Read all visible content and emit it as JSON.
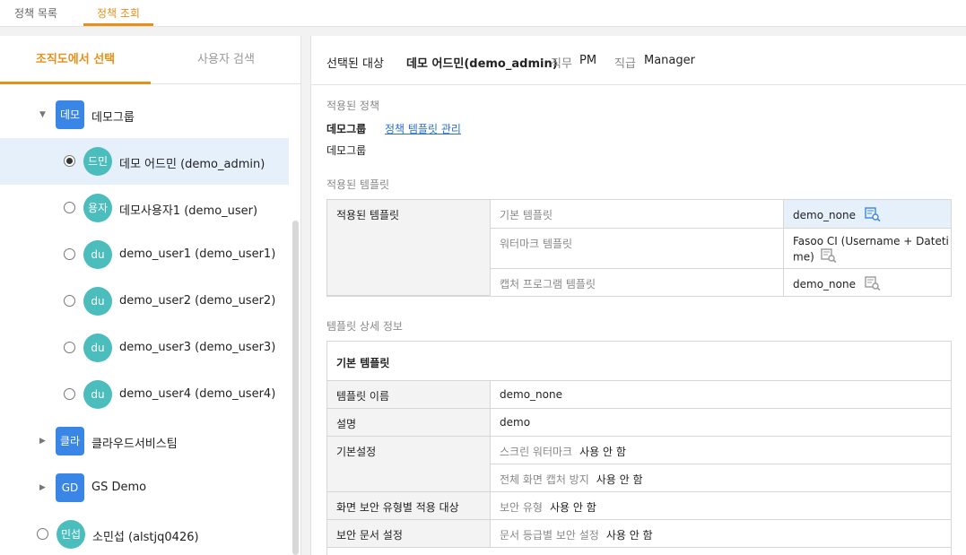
{
  "top_tabs": [
    "정책 목록",
    "정책 조회"
  ],
  "left_tabs": [
    "조직도에서 선택",
    "사용자 검색"
  ],
  "tree": [
    {
      "type": "group",
      "badge": "데모",
      "label": "데모그룹",
      "expanded": true
    },
    {
      "type": "user",
      "badge": "드민",
      "label": "데모 어드민 (demo_admin)",
      "selected": true
    },
    {
      "type": "user",
      "badge": "용자",
      "label": "데모사용자1 (demo_user)",
      "selected": false
    },
    {
      "type": "user",
      "badge": "du",
      "label": "demo_user1 (demo_user1)",
      "selected": false
    },
    {
      "type": "user",
      "badge": "du",
      "label": "demo_user2 (demo_user2)",
      "selected": false
    },
    {
      "type": "user",
      "badge": "du",
      "label": "demo_user3 (demo_user3)",
      "selected": false
    },
    {
      "type": "user",
      "badge": "du",
      "label": "demo_user4 (demo_user4)",
      "selected": false
    },
    {
      "type": "group",
      "badge": "클라",
      "label": "클라우드서비스팀",
      "expanded": false
    },
    {
      "type": "group",
      "badge": "GD",
      "label": "GS Demo",
      "expanded": false
    },
    {
      "type": "user",
      "badge": "민섭",
      "label": "소민섭 (alstjq0426)",
      "selected": false
    }
  ],
  "header": {
    "selected_label": "선택된 대상",
    "selected_value": "데모 어드민(demo_admin)",
    "duty_label": "직무",
    "duty_value": "PM",
    "rank_label": "직급",
    "rank_value": "Manager"
  },
  "applied_policy": {
    "title": "적용된 정책",
    "group": "데모그룹",
    "manage_link": "정책 템플릿 관리",
    "group2": "데모그룹"
  },
  "applied_templates": {
    "title": "적용된 템플릿",
    "row_label": "적용된 템플릿",
    "rows": [
      {
        "name": "기본 템플릿",
        "value": "demo_none"
      },
      {
        "name": "워터마크 템플릿",
        "value_line1": "Fasoo CI (Username + Dateti",
        "value_line2": "me)"
      },
      {
        "name": "캡처 프로그램 템플릿",
        "value": "demo_none"
      }
    ]
  },
  "template_detail": {
    "title": "템플릿 상세 정보",
    "box_title": "기본 템플릿",
    "name_label": "템플릿 이름",
    "name_value": "demo_none",
    "desc_label": "설명",
    "desc_value": "demo",
    "basic_label": "기본설정",
    "screen_wm_label": "스크린 워터마크",
    "screen_wm_value": "사용 안 함",
    "full_capture_label": "전체 화면 캡처 방지",
    "full_capture_value": "사용 안 함",
    "sec_type_target_label": "화면 보안 유형별 적용 대상",
    "sec_type_label": "보안 유형",
    "sec_type_value": "사용 안 함",
    "doc_sec_label": "보안 문서 설정",
    "doc_grade_label": "문서 등급별 보안 설정",
    "doc_grade_value": "사용 안 함"
  },
  "colors": {
    "accent": "#e8901a",
    "group_badge": "#3a86e6",
    "user_badge": "#4cbdbd",
    "link": "#2a6fd1",
    "selected_row": "#e6f0fb"
  }
}
